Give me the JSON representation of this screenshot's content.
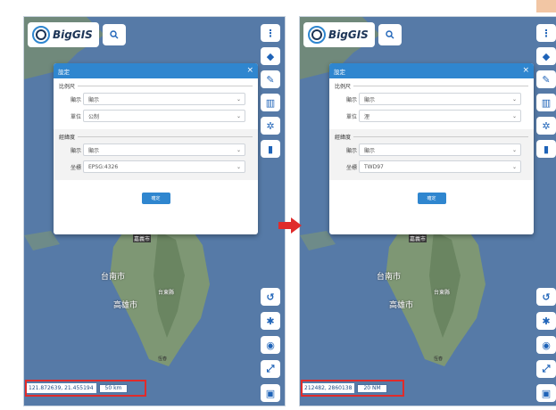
{
  "app": {
    "logo_text": "BigGIS"
  },
  "dialog": {
    "title": "設定",
    "close_symbol": "×",
    "scale_section": "比例尺",
    "coord_section": "經緯度",
    "label_display": "顯示",
    "label_unit": "單位",
    "label_coord_system": "坐標",
    "confirm_label": "確定"
  },
  "before": {
    "scale_display": "顯示",
    "scale_unit": "公制",
    "coord_display": "顯示",
    "coord_system": "EPSG:4326",
    "coordinates": "121.872639, 21.455194",
    "scale_bar": "50 km"
  },
  "after": {
    "scale_display": "顯示",
    "scale_unit": "浬",
    "coord_display": "顯示",
    "coord_system": "TWD97",
    "coordinates": "212482, 2860138",
    "scale_bar": "20 NM"
  },
  "map_labels": {
    "chiayi": "嘉義市",
    "tainan": "台南市",
    "kaohsiung": "高雄市",
    "taitung": "台東縣",
    "hengchun": "恆春"
  },
  "colors": {
    "sea": "#6f9fd6",
    "land": "#a7c78f",
    "accent": "#2f86cf",
    "highlight": "#e02b2b"
  },
  "icons": [
    "search-icon",
    "more-vertical-icon",
    "layers-icon",
    "map-tools-icon",
    "map-icon",
    "gear-icon",
    "trash-icon",
    "refresh-icon",
    "tools-icon",
    "locate-icon",
    "fullscreen-icon",
    "lock-icon"
  ]
}
